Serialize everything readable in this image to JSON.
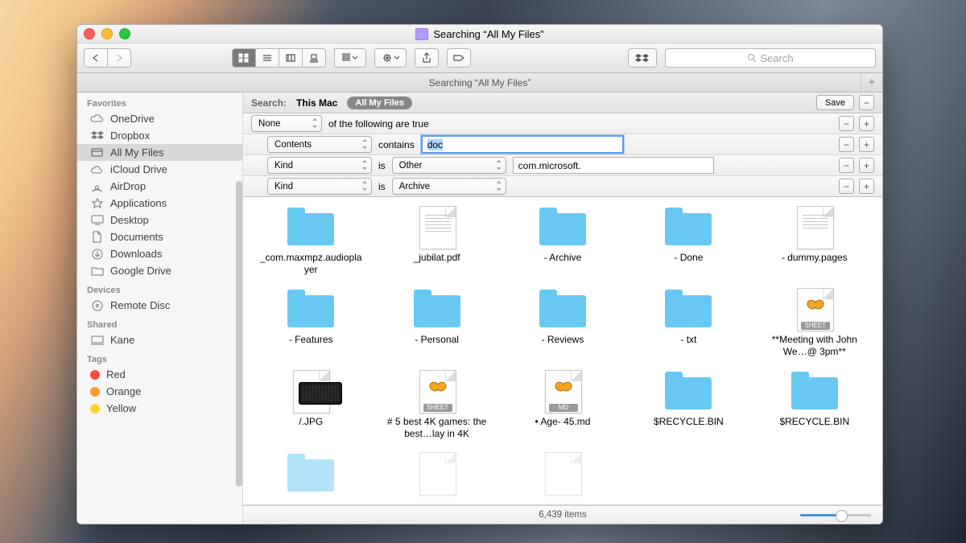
{
  "window_title": "Searching “All My Files”",
  "tabbar_title": "Searching “All My Files”",
  "search_placeholder": "Search",
  "scope": {
    "label": "Search:",
    "this_mac": "This Mac",
    "all_my_files": "All My Files",
    "save": "Save"
  },
  "rules": {
    "r0": {
      "attr": "None",
      "text": "of the following are true"
    },
    "r1": {
      "attr": "Contents",
      "op": "contains",
      "value": "doc"
    },
    "r2": {
      "attr": "Kind",
      "op": "is",
      "kind": "Other",
      "value": "com.microsoft."
    },
    "r3": {
      "attr": "Kind",
      "op": "is",
      "kind": "Archive"
    }
  },
  "sidebar": {
    "favorites_h": "Favorites",
    "devices_h": "Devices",
    "shared_h": "Shared",
    "tags_h": "Tags",
    "items": {
      "onedrive": "OneDrive",
      "dropbox": "Dropbox",
      "allmyfiles": "All My Files",
      "iclouddrive": "iCloud Drive",
      "airdrop": "AirDrop",
      "applications": "Applications",
      "desktop": "Desktop",
      "documents": "Documents",
      "downloads": "Downloads",
      "googledrive": "Google Drive",
      "remotedisc": "Remote Disc",
      "kane": "Kane"
    },
    "tags": {
      "red": "Red",
      "orange": "Orange",
      "yellow": "Yellow"
    }
  },
  "results": {
    "i0": "_com.maxmpz.audioplayer",
    "i1": "_jubilat.pdf",
    "i2": "- Archive",
    "i3": "- Done",
    "i4": "- dummy.pages",
    "i5": "- Features",
    "i6": "- Personal",
    "i7": "- Reviews",
    "i8": "- txt",
    "i9": "**Meeting with John We…@ 3pm**",
    "i10": "/.JPG",
    "i11": "# 5 best 4K games: the best…lay in 4K",
    "i12": "• Age- 45.md",
    "i13": "$RECYCLE.BIN",
    "i14": "$RECYCLE.BIN"
  },
  "status": {
    "count_text": "6,439 items"
  },
  "badges": {
    "sheet": "SHEET",
    "md": "MD"
  }
}
